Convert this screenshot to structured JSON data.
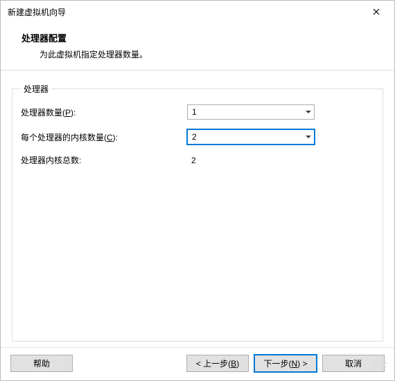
{
  "window": {
    "title": "新建虚拟机向导"
  },
  "header": {
    "title": "处理器配置",
    "subtitle": "为此虚拟机指定处理器数量。"
  },
  "group": {
    "legend": "处理器",
    "rows": {
      "processors": {
        "label_pre": "处理器数量(",
        "hotkey": "P",
        "label_post": "):",
        "value": "1"
      },
      "cores": {
        "label_pre": "每个处理器的内核数量(",
        "hotkey": "C",
        "label_post": "):",
        "value": "2"
      },
      "total": {
        "label": "处理器内核总数:",
        "value": "2"
      }
    }
  },
  "buttons": {
    "help": "帮助",
    "back": "< 上一步(B)",
    "next": "下一步(N) >",
    "cancel": "取消"
  },
  "watermark": "博客"
}
